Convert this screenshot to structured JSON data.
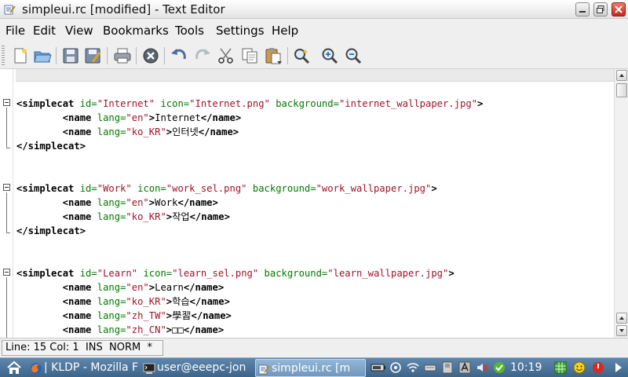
{
  "window": {
    "title": "simpleui.rc [modified] - Text Editor"
  },
  "menu": [
    "File",
    "Edit",
    "View",
    "Bookmarks",
    "Tools",
    "Settings",
    "Help"
  ],
  "toolbar_icons": [
    "new-document-icon",
    "open-folder-icon",
    "save-icon",
    "save-as-icon",
    "print-icon",
    "close-document-icon",
    "undo-icon",
    "redo-icon",
    "cut-icon",
    "copy-icon",
    "paste-icon",
    "find-icon",
    "zoom-in-icon",
    "zoom-out-icon"
  ],
  "editor": {
    "lines": [
      [
        {
          "t": "tag",
          "s": "<simplecat "
        },
        {
          "t": "attr",
          "s": "id="
        },
        {
          "t": "val",
          "s": "\"Internet\""
        },
        {
          "t": "txt",
          "s": " "
        },
        {
          "t": "attr",
          "s": "icon="
        },
        {
          "t": "val",
          "s": "\"Internet.png\""
        },
        {
          "t": "txt",
          "s": " "
        },
        {
          "t": "attr",
          "s": "background="
        },
        {
          "t": "val",
          "s": "\"internet_wallpaper.jpg\""
        },
        {
          "t": "tag",
          "s": ">"
        }
      ],
      [
        {
          "t": "txt",
          "s": "        "
        },
        {
          "t": "tag",
          "s": "<name "
        },
        {
          "t": "attr",
          "s": "lang="
        },
        {
          "t": "val",
          "s": "\"en\""
        },
        {
          "t": "tag",
          "s": ">"
        },
        {
          "t": "txt",
          "s": "Internet"
        },
        {
          "t": "tag",
          "s": "</name>"
        }
      ],
      [
        {
          "t": "txt",
          "s": "        "
        },
        {
          "t": "tag",
          "s": "<name "
        },
        {
          "t": "attr",
          "s": "lang="
        },
        {
          "t": "val",
          "s": "\"ko_KR\""
        },
        {
          "t": "tag",
          "s": ">"
        },
        {
          "t": "txt",
          "s": "인터넷"
        },
        {
          "t": "tag",
          "s": "</name>"
        }
      ],
      [
        {
          "t": "tag",
          "s": "</simplecat>"
        }
      ],
      [],
      [],
      [
        {
          "t": "tag",
          "s": "<simplecat "
        },
        {
          "t": "attr",
          "s": "id="
        },
        {
          "t": "val",
          "s": "\"Work\""
        },
        {
          "t": "txt",
          "s": " "
        },
        {
          "t": "attr",
          "s": "icon="
        },
        {
          "t": "val",
          "s": "\"work_sel.png\""
        },
        {
          "t": "txt",
          "s": " "
        },
        {
          "t": "attr",
          "s": "background="
        },
        {
          "t": "val",
          "s": "\"work_wallpaper.jpg\""
        },
        {
          "t": "tag",
          "s": ">"
        }
      ],
      [
        {
          "t": "txt",
          "s": "        "
        },
        {
          "t": "tag",
          "s": "<name "
        },
        {
          "t": "attr",
          "s": "lang="
        },
        {
          "t": "val",
          "s": "\"en\""
        },
        {
          "t": "tag",
          "s": ">"
        },
        {
          "t": "txt",
          "s": "Work"
        },
        {
          "t": "tag",
          "s": "</name>"
        }
      ],
      [
        {
          "t": "txt",
          "s": "        "
        },
        {
          "t": "tag",
          "s": "<name "
        },
        {
          "t": "attr",
          "s": "lang="
        },
        {
          "t": "val",
          "s": "\"ko_KR\""
        },
        {
          "t": "tag",
          "s": ">"
        },
        {
          "t": "txt",
          "s": "작업"
        },
        {
          "t": "tag",
          "s": "</name>"
        }
      ],
      [
        {
          "t": "tag",
          "s": "</simplecat>"
        }
      ],
      [],
      [],
      [
        {
          "t": "tag",
          "s": "<simplecat "
        },
        {
          "t": "attr",
          "s": "id="
        },
        {
          "t": "val",
          "s": "\"Learn\""
        },
        {
          "t": "txt",
          "s": " "
        },
        {
          "t": "attr",
          "s": "icon="
        },
        {
          "t": "val",
          "s": "\"learn_sel.png\""
        },
        {
          "t": "txt",
          "s": " "
        },
        {
          "t": "attr",
          "s": "background="
        },
        {
          "t": "val",
          "s": "\"learn_wallpaper.jpg\""
        },
        {
          "t": "tag",
          "s": ">"
        }
      ],
      [
        {
          "t": "txt",
          "s": "        "
        },
        {
          "t": "tag",
          "s": "<name "
        },
        {
          "t": "attr",
          "s": "lang="
        },
        {
          "t": "val",
          "s": "\"en\""
        },
        {
          "t": "tag",
          "s": ">"
        },
        {
          "t": "txt",
          "s": "Learn"
        },
        {
          "t": "tag",
          "s": "</name>"
        }
      ],
      [
        {
          "t": "txt",
          "s": "        "
        },
        {
          "t": "tag",
          "s": "<name "
        },
        {
          "t": "attr",
          "s": "lang="
        },
        {
          "t": "val",
          "s": "\"ko_KR\""
        },
        {
          "t": "tag",
          "s": ">"
        },
        {
          "t": "txt",
          "s": "학습"
        },
        {
          "t": "tag",
          "s": "</name>"
        }
      ],
      [
        {
          "t": "txt",
          "s": "        "
        },
        {
          "t": "tag",
          "s": "<name "
        },
        {
          "t": "attr",
          "s": "lang="
        },
        {
          "t": "val",
          "s": "\"zh_TW\""
        },
        {
          "t": "tag",
          "s": ">"
        },
        {
          "t": "txt",
          "s": "學習"
        },
        {
          "t": "tag",
          "s": "</name>"
        }
      ],
      [
        {
          "t": "txt",
          "s": "        "
        },
        {
          "t": "tag",
          "s": "<name "
        },
        {
          "t": "attr",
          "s": "lang="
        },
        {
          "t": "val",
          "s": "\"zh_CN\""
        },
        {
          "t": "tag",
          "s": ">"
        },
        {
          "t": "txt",
          "s": "□□"
        },
        {
          "t": "tag",
          "s": "</name>"
        }
      ]
    ]
  },
  "status": {
    "text": "Line: 15 Col: 1  INS  NORM  *"
  },
  "taskbar": {
    "tasks": [
      {
        "label": "| KLDP - Mozilla F",
        "icon": "firefox-icon",
        "active": false
      },
      {
        "label": "user@eeepc-jon",
        "icon": "terminal-icon",
        "active": false
      },
      {
        "label": "simpleui.rc [m",
        "icon": "text-editor-icon",
        "active": true
      }
    ],
    "clock": "10:19"
  }
}
